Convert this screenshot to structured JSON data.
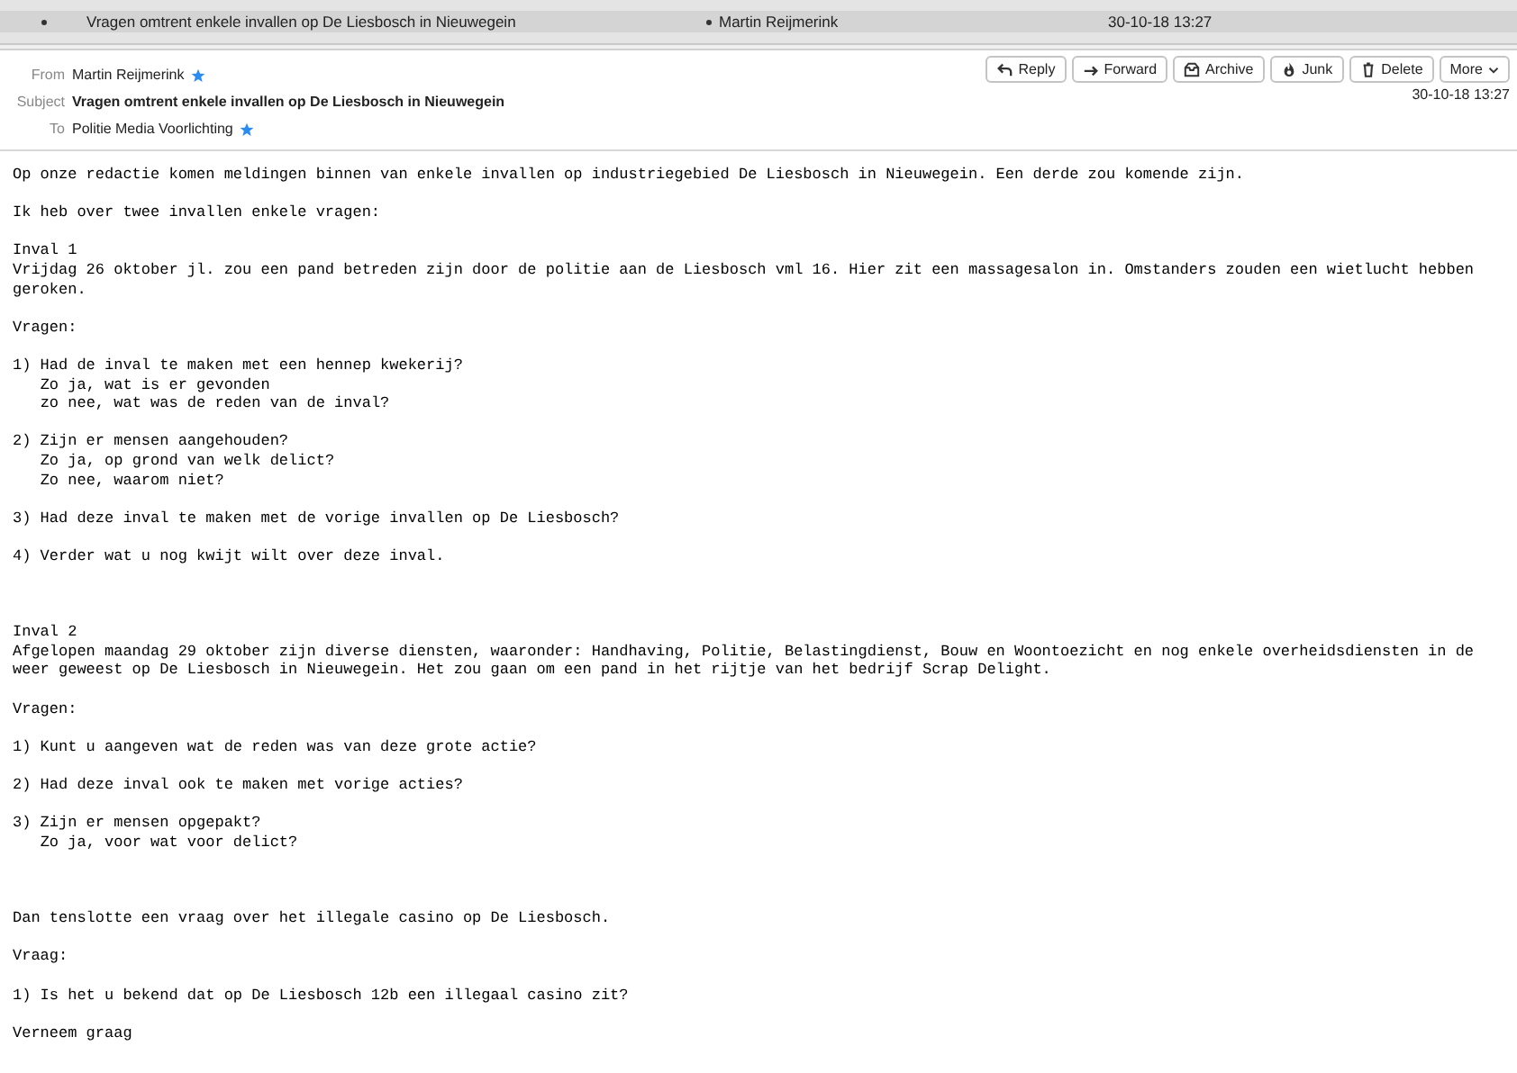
{
  "message_list": {
    "rows": [
      {
        "subject": "Vragen omtrent enkele invallen op De Liesbosch in Nieuwegein",
        "from": "Martin Reijmerink",
        "date": "30-10-18 13:27",
        "selected": true,
        "unread": true
      }
    ]
  },
  "header": {
    "from_label": "From",
    "from": "Martin Reijmerink",
    "subject_label": "Subject",
    "subject": "Vragen omtrent enkele invallen op De Liesbosch in Nieuwegein",
    "to_label": "To",
    "to": "Politie Media Voorlichting",
    "date": "30-10-18 13:27",
    "buttons": [
      {
        "kind": "reply",
        "label": "Reply"
      },
      {
        "kind": "forward",
        "label": "Forward"
      },
      {
        "kind": "archive",
        "label": "Archive"
      },
      {
        "kind": "junk",
        "label": "Junk"
      },
      {
        "kind": "delete",
        "label": "Delete"
      },
      {
        "kind": "more",
        "label": "More"
      }
    ]
  },
  "body": {
    "sections": [
      {
        "paragraphs": [
          "Op onze redactie komen meldingen binnen van enkele invallen op industriegebied De Liesbosch in Nieuwegein. Een derde zou komende zijn.",
          "Ik heb over twee invallen enkele vragen:",
          "Inval 1\nVrijdag 26 oktober jl. zou een pand betreden zijn door de politie aan de Liesbosch vml 16. Hier zit een massagesalon in. Omstanders zouden een wietlucht hebben geroken.",
          "Vragen:",
          "1) Had de inval te maken met een hennep kwekerij?\n   Zo ja, wat is er gevonden\n   zo nee, wat was de reden van de inval?",
          "2) Zijn er mensen aangehouden?\n   Zo ja, op grond van welk delict?\n   Zo nee, waarom niet?",
          "3) Had deze inval te maken met de vorige invallen op De Liesbosch?",
          "4) Verder wat u nog kwijt wilt over deze inval."
        ]
      },
      {
        "paragraphs": [
          "Inval 2\nAfgelopen maandag 29 oktober zijn diverse diensten, waaronder: Handhaving, Politie, Belastingdienst, Bouw en Woontoezicht en nog enkele overheidsdiensten in de weer geweest op De Liesbosch in Nieuwegein. Het zou gaan om een pand in het rijtje van het bedrijf Scrap Delight.",
          "Vragen:",
          "1) Kunt u aangeven wat de reden was van deze grote actie?",
          "2) Had deze inval ook te maken met vorige acties?",
          "3) Zijn er mensen opgepakt?\n   Zo ja, voor wat voor delict?"
        ]
      },
      {
        "paragraphs": [
          "Dan tenslotte een vraag over het illegale casino op De Liesbosch.",
          "Vraag:",
          "1) Is het u bekend dat op De Liesbosch 12b een illegaal casino zit?",
          "Verneem graag"
        ]
      }
    ]
  }
}
